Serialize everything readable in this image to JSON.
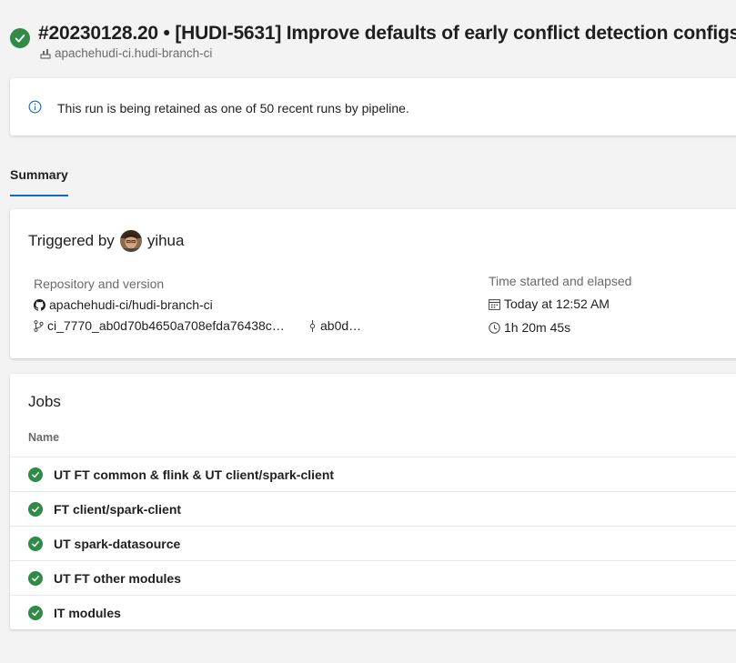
{
  "header": {
    "title": "#20230128.20 • [HUDI-5631] Improve defaults of early conflict detection configs",
    "pipeline": "apachehudi-ci.hudi-branch-ci"
  },
  "banner": {
    "message": "This run is being retained as one of 50 recent runs by pipeline."
  },
  "tabs": [
    {
      "label": "Summary",
      "active": true
    }
  ],
  "triggered": {
    "label": "Triggered by",
    "user": "yihua",
    "repo_heading": "Repository and version",
    "repository": "apachehudi-ci/hudi-branch-ci",
    "branch": "ci_7770_ab0d70b4650a708efda76438c…",
    "commit": "ab0d…",
    "time_heading": "Time started and elapsed",
    "started": "Today at 12:52 AM",
    "elapsed": "1h 20m 45s"
  },
  "jobs": {
    "title": "Jobs",
    "column_name": "Name",
    "items": [
      {
        "name": "UT FT common & flink & UT client/spark-client",
        "status": "succeeded"
      },
      {
        "name": "FT client/spark-client",
        "status": "succeeded"
      },
      {
        "name": "UT spark-datasource",
        "status": "succeeded"
      },
      {
        "name": "UT FT other modules",
        "status": "succeeded"
      },
      {
        "name": "IT modules",
        "status": "succeeded"
      }
    ]
  },
  "colors": {
    "success": "#2f8b46",
    "accent": "#0f6cbd",
    "muted_text": "#6a6a6a",
    "page_bg": "#f3f3f3"
  }
}
